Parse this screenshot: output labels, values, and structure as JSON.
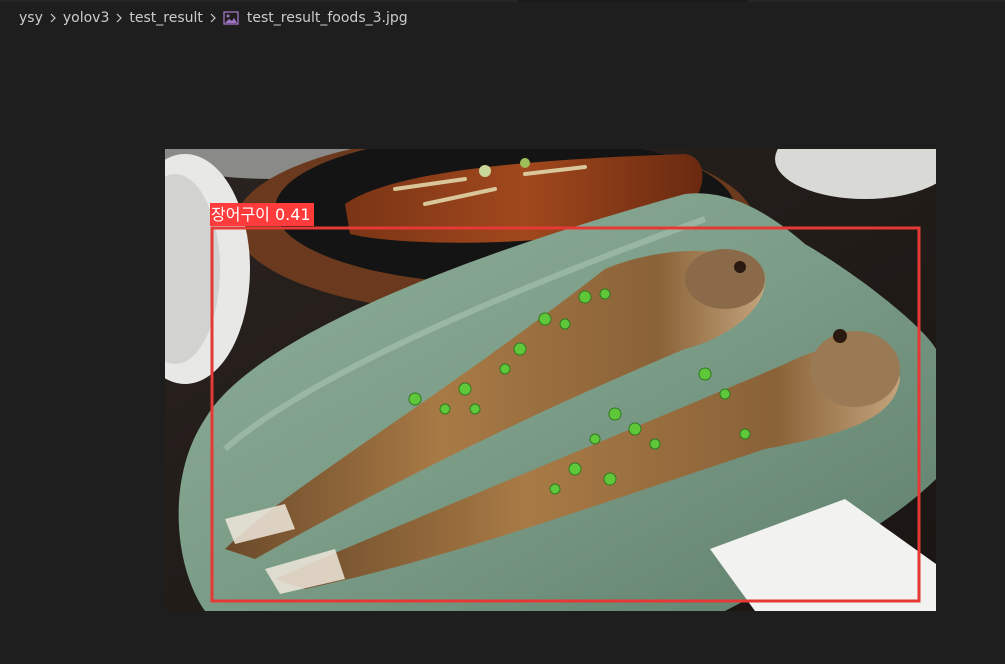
{
  "breadcrumb": {
    "items": [
      "ysy",
      "yolov3",
      "test_result"
    ],
    "file": "test_result_foods_3.jpg",
    "separator_icon": "chevron-right-icon",
    "file_icon": "image-file-icon"
  },
  "image": {
    "description_icon": "image-preview",
    "detection": {
      "label": "장어구이 0.41",
      "box_color": "#e53935"
    }
  },
  "colors": {
    "background": "#1e1e1e",
    "text": "#cccccc",
    "label_bg": "#ff3b3b",
    "file_icon": "#a074c4"
  }
}
